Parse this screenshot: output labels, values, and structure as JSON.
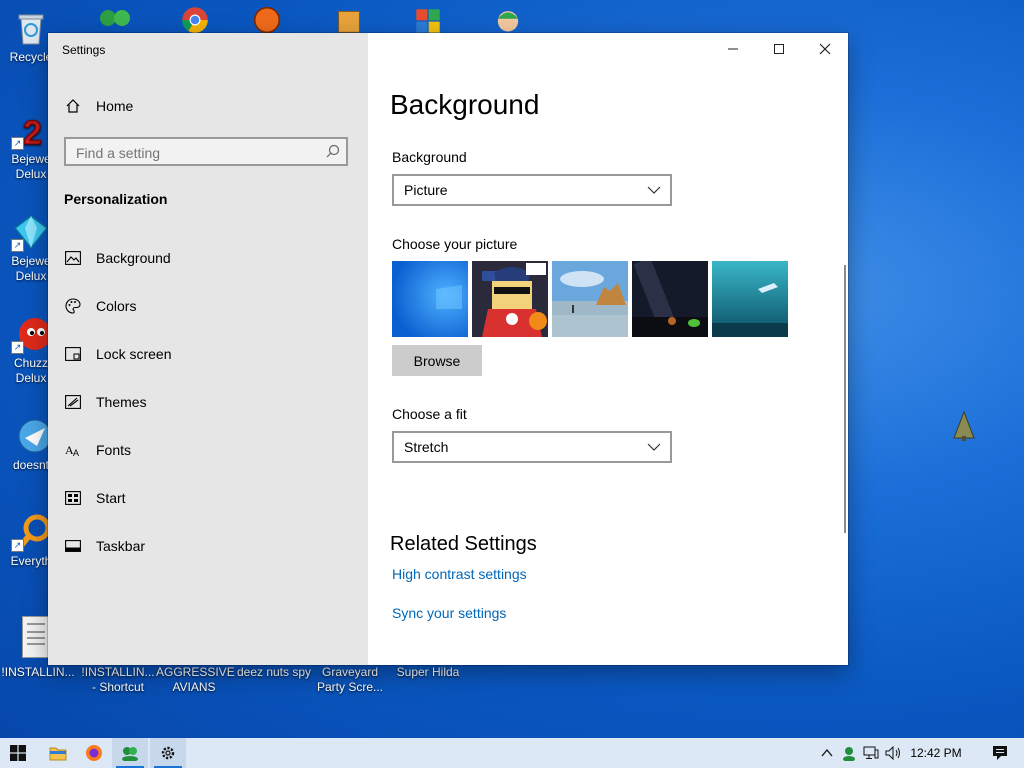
{
  "desktop": {
    "icons_left": [
      {
        "label": "Recycle",
        "kind": "recycle"
      },
      {
        "label": "Bejewe\nDelux",
        "kind": "bejeweled2"
      },
      {
        "label": "Bejewe\nDelux",
        "kind": "bejeweled"
      },
      {
        "label": "Chuzz\nDelux",
        "kind": "chuzzle"
      },
      {
        "label": "doesnt",
        "kind": "app"
      },
      {
        "label": "Everyth",
        "kind": "search"
      }
    ],
    "icons_bottom": [
      {
        "label": "!INSTALLIN..."
      },
      {
        "label": "!INSTALLIN...\n- Shortcut"
      },
      {
        "label": "AGGRESSIVE\nAVIANS"
      },
      {
        "label": "deez nuts spy"
      },
      {
        "label": "Graveyard\nParty Scre..."
      },
      {
        "label": "Super Hilda"
      }
    ]
  },
  "window": {
    "title": "Settings",
    "caption": {
      "minimize": "—",
      "maximize": "☐",
      "close": "✕"
    }
  },
  "sidebar": {
    "home_label": "Home",
    "search_placeholder": "Find a setting",
    "section": "Personalization",
    "items": [
      {
        "label": "Background",
        "icon": "picture-icon"
      },
      {
        "label": "Colors",
        "icon": "palette-icon"
      },
      {
        "label": "Lock screen",
        "icon": "lock-screen-icon"
      },
      {
        "label": "Themes",
        "icon": "themes-icon"
      },
      {
        "label": "Fonts",
        "icon": "fonts-icon"
      },
      {
        "label": "Start",
        "icon": "start-icon"
      },
      {
        "label": "Taskbar",
        "icon": "taskbar-icon"
      }
    ]
  },
  "content": {
    "title": "Background",
    "background_label": "Background",
    "background_value": "Picture",
    "choose_picture_label": "Choose your picture",
    "browse_label": "Browse",
    "fit_label": "Choose a fit",
    "fit_value": "Stretch",
    "related_title": "Related Settings",
    "links": [
      "High contrast settings",
      "Sync your settings"
    ]
  },
  "taskbar": {
    "time": "12:42 PM"
  },
  "colors": {
    "accent": "#0067b8",
    "sidebar": "#e6e6e6",
    "taskbar": "#dce8f5"
  }
}
